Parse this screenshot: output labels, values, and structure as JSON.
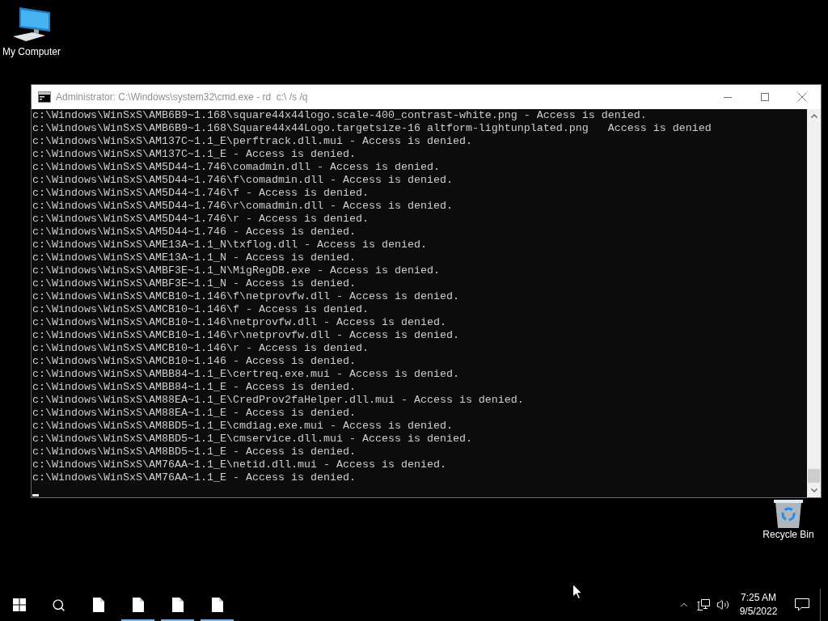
{
  "desktop": {
    "computer_icon": {
      "label": "My Computer"
    },
    "recycle_bin": {
      "label": "Recycle Bin"
    }
  },
  "window": {
    "title": "Administrator: C:\\Windows\\system32\\cmd.exe - rd  c:\\ /s /q",
    "console_lines": [
      "c:\\Windows\\WinSxS\\AMB6B9~1.168\\square44x44logo.scale-400_contrast-white.png - Access is denied.",
      "c:\\Windows\\WinSxS\\AMB6B9~1.168\\Square44x44Logo.targetsize-16 altform-lightunplated.png   Access is denied",
      "c:\\Windows\\WinSxS\\AM137C~1.1_E\\perftrack.dll.mui - Access is denied.",
      "c:\\Windows\\WinSxS\\AM137C~1.1_E - Access is denied.",
      "c:\\Windows\\WinSxS\\AM5D44~1.746\\comadmin.dll - Access is denied.",
      "c:\\Windows\\WinSxS\\AM5D44~1.746\\f\\comadmin.dll - Access is denied.",
      "c:\\Windows\\WinSxS\\AM5D44~1.746\\f - Access is denied.",
      "c:\\Windows\\WinSxS\\AM5D44~1.746\\r\\comadmin.dll - Access is denied.",
      "c:\\Windows\\WinSxS\\AM5D44~1.746\\r - Access is denied.",
      "c:\\Windows\\WinSxS\\AM5D44~1.746 - Access is denied.",
      "c:\\Windows\\WinSxS\\AME13A~1.1_N\\txflog.dll - Access is denied.",
      "c:\\Windows\\WinSxS\\AME13A~1.1_N - Access is denied.",
      "c:\\Windows\\WinSxS\\AMBF3E~1.1_N\\MigRegDB.exe - Access is denied.",
      "c:\\Windows\\WinSxS\\AMBF3E~1.1_N - Access is denied.",
      "c:\\Windows\\WinSxS\\AMCB10~1.146\\f\\netprovfw.dll - Access is denied.",
      "c:\\Windows\\WinSxS\\AMCB10~1.146\\f - Access is denied.",
      "c:\\Windows\\WinSxS\\AMCB10~1.146\\netprovfw.dll - Access is denied.",
      "c:\\Windows\\WinSxS\\AMCB10~1.146\\r\\netprovfw.dll - Access is denied.",
      "c:\\Windows\\WinSxS\\AMCB10~1.146\\r - Access is denied.",
      "c:\\Windows\\WinSxS\\AMCB10~1.146 - Access is denied.",
      "c:\\Windows\\WinSxS\\AMBB84~1.1_E\\certreq.exe.mui - Access is denied.",
      "c:\\Windows\\WinSxS\\AMBB84~1.1_E - Access is denied.",
      "c:\\Windows\\WinSxS\\AM88EA~1.1_E\\CredProv2faHelper.dll.mui - Access is denied.",
      "c:\\Windows\\WinSxS\\AM88EA~1.1_E - Access is denied.",
      "c:\\Windows\\WinSxS\\AM8BD5~1.1_E\\cmdiag.exe.mui - Access is denied.",
      "c:\\Windows\\WinSxS\\AM8BD5~1.1_E\\cmservice.dll.mui - Access is denied.",
      "c:\\Windows\\WinSxS\\AM8BD5~1.1_E - Access is denied.",
      "c:\\Windows\\WinSxS\\AM76AA~1.1_E\\netid.dll.mui - Access is denied.",
      "c:\\Windows\\WinSxS\\AM76AA~1.1_E - Access is denied."
    ]
  },
  "taskbar": {
    "apps": [
      {
        "open": false
      },
      {
        "open": true
      },
      {
        "open": true
      },
      {
        "open": true
      }
    ],
    "clock": {
      "time": "7:25 AM",
      "date": "9/5/2022"
    }
  }
}
